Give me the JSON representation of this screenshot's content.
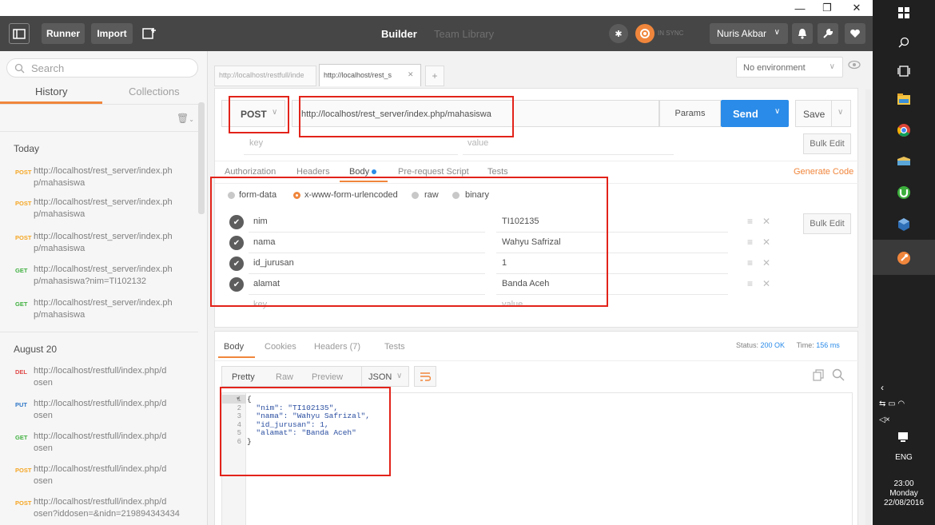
{
  "window": {
    "minimize": "—",
    "restore": "❐",
    "close": "✕"
  },
  "header": {
    "runner": "Runner",
    "import": "Import",
    "builder": "Builder",
    "team_library": "Team Library",
    "sync": "IN SYNC",
    "user": "Nuris Akbar"
  },
  "sidebar": {
    "search_placeholder": "Search",
    "tabs": [
      "History",
      "Collections"
    ],
    "groups": [
      {
        "label": "Today",
        "items": [
          {
            "method": "POST",
            "url": "http://localhost/rest_server/index.ph p/mahasiswa"
          },
          {
            "method": "POST",
            "url": "http://localhost/rest_server/index.ph p/mahasiswa"
          },
          {
            "method": "POST",
            "url": "http://localhost/rest_server/index.ph p/mahasiswa"
          },
          {
            "method": "GET",
            "url": "http://localhost/rest_server/index.ph p/mahasiswa?nim=TI102132"
          },
          {
            "method": "GET",
            "url": "http://localhost/rest_server/index.ph p/mahasiswa"
          }
        ]
      },
      {
        "label": "August 20",
        "items": [
          {
            "method": "DEL",
            "url": "http://localhost/restfull/index.php/d osen"
          },
          {
            "method": "PUT",
            "url": "http://localhost/restfull/index.php/d osen"
          },
          {
            "method": "GET",
            "url": "http://localhost/restfull/index.php/d osen"
          },
          {
            "method": "POST",
            "url": "http://localhost/restfull/index.php/d osen"
          },
          {
            "method": "POST",
            "url": "http://localhost/restfull/index.php/d osen?iddosen=&nidn=219894343434"
          }
        ]
      }
    ]
  },
  "tabs": {
    "tab1": "http://localhost/restfull/inde",
    "tab2": "http://localhost/rest_s",
    "tab2_close": "✕",
    "add": "+",
    "environment": "No environment"
  },
  "request": {
    "method": "POST",
    "url": "http://localhost/rest_server/index.php/mahasiswa",
    "params": "Params",
    "send": "Send",
    "save": "Save",
    "key_placeholder": "key",
    "value_placeholder": "value",
    "bulk_edit": "Bulk Edit"
  },
  "req_tabs": {
    "items": [
      "Authorization",
      "Headers",
      "Body",
      "Pre-request Script",
      "Tests"
    ],
    "generate_code": "Generate Code"
  },
  "body": {
    "modes": [
      "form-data",
      "x-www-form-urlencoded",
      "raw",
      "binary"
    ],
    "selected_mode": "x-www-form-urlencoded",
    "rows": [
      {
        "key": "nim",
        "value": "TI102135"
      },
      {
        "key": "nama",
        "value": "Wahyu Safrizal"
      },
      {
        "key": "id_jurusan",
        "value": "1"
      },
      {
        "key": "alamat",
        "value": "Banda Aceh"
      }
    ],
    "key_placeholder": "key",
    "value_placeholder": "value",
    "bulk_edit": "Bulk Edit"
  },
  "response": {
    "tabs": [
      "Body",
      "Cookies",
      "Headers (7)",
      "Tests"
    ],
    "status_label": "Status:",
    "status_value": "200 OK",
    "time_label": "Time:",
    "time_value": "156 ms",
    "views": [
      "Pretty",
      "Raw",
      "Preview"
    ],
    "format": "JSON",
    "line_numbers": [
      "1",
      "2",
      "3",
      "4",
      "5",
      "6"
    ],
    "code_lines": [
      "{",
      "  \"nim\": \"TI102135\",",
      "  \"nama\": \"Wahyu Safrizal\",",
      "  \"id_jurusan\": 1,",
      "  \"alamat\": \"Banda Aceh\"",
      "}"
    ]
  },
  "taskbar": {
    "lang": "ENG",
    "time": "23:00",
    "day": "Monday",
    "date": "22/08/2016"
  },
  "colors": {
    "post": "#f5a623",
    "get": "#3fb03f",
    "del": "#e04b4b",
    "put": "#2f77c7",
    "accent": "#2a8be8",
    "orange": "#f0863c"
  }
}
